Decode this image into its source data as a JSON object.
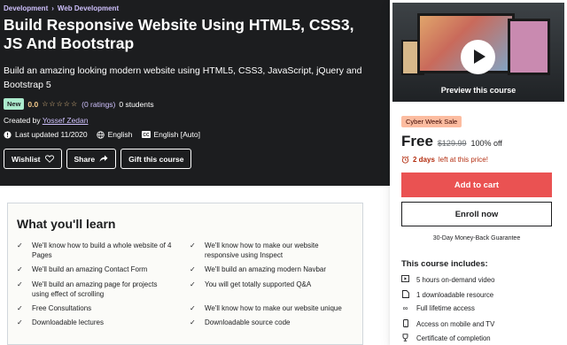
{
  "breadcrumb": {
    "items": [
      "Development",
      "Web Development"
    ],
    "separator": "›"
  },
  "course": {
    "title": "Build Responsive Website Using HTML5, CSS3, JS And Bootstrap",
    "subtitle": "Build an amazing looking modern website using HTML5, CSS3, JavaScript, jQuery and Bootstrap 5",
    "badge": "New",
    "rating": "0.0",
    "stars": "☆☆☆☆☆",
    "ratings_text": "(0 ratings)",
    "students_text": "0 students",
    "created_by_label": "Created by",
    "instructor": "Yossef Zedan",
    "last_updated": "Last updated 11/2020",
    "language": "English",
    "captions": "English [Auto]"
  },
  "actions": {
    "wishlist": "Wishlist",
    "share": "Share",
    "gift": "Gift this course"
  },
  "learn": {
    "heading": "What you'll learn",
    "items": [
      "We'll know how to build a whole website of 4 Pages",
      "We'll know how to make our website responsive using Inspect",
      "We'll build an amazing Contact Form",
      "We'll build an amazing modern Navbar",
      "We'll build an amazing page for projects using effect of scrolling",
      "You will get totally supported Q&A",
      "Free Consultations",
      "We'll know how to make our website unique",
      "Downloadable lectures",
      "Downloadable source code"
    ]
  },
  "sidebar": {
    "preview_label": "Preview this course",
    "sale_badge": "Cyber Week Sale",
    "price": "Free",
    "original_price": "$129.99",
    "discount": "100% off",
    "timer_bold": "2 days",
    "timer_rest": "left at this price!",
    "add_to_cart": "Add to cart",
    "enroll_now": "Enroll now",
    "guarantee": "30-Day Money-Back Guarantee",
    "includes_heading": "This course includes:",
    "includes": [
      "5 hours on-demand video",
      "1 downloadable resource",
      "Full lifetime access",
      "Access on mobile and TV",
      "Certificate of completion"
    ]
  },
  "colors": {
    "hero_bg": "#1c1d1f",
    "link": "#cec0fc",
    "cart": "#ea5252",
    "star": "#f3ca8c",
    "badge_new": "#acebcd",
    "sale": "#fcbca0"
  }
}
